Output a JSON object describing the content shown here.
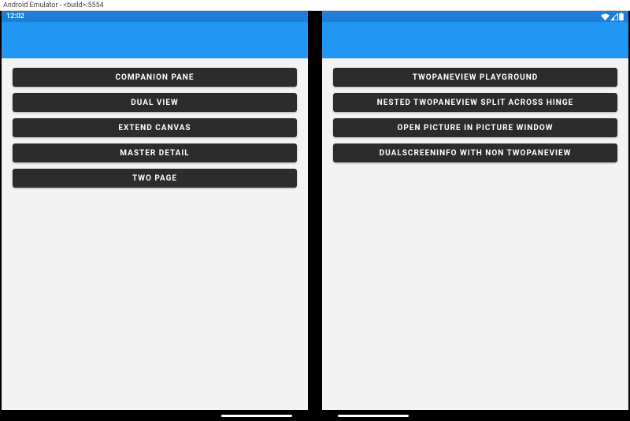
{
  "window": {
    "title": "Android Emulator - <build>:5554"
  },
  "status": {
    "time": "12:02"
  },
  "left_pane": {
    "buttons": [
      {
        "label": "COMPANION PANE"
      },
      {
        "label": "DUAL VIEW"
      },
      {
        "label": "EXTEND CANVAS"
      },
      {
        "label": "MASTER DETAIL"
      },
      {
        "label": "TWO PAGE"
      }
    ]
  },
  "right_pane": {
    "buttons": [
      {
        "label": "TWOPANEVIEW PLAYGROUND"
      },
      {
        "label": "NESTED TWOPANEVIEW SPLIT ACROSS HINGE"
      },
      {
        "label": "OPEN PICTURE IN PICTURE WINDOW"
      },
      {
        "label": "DUALSCREENINFO WITH NON TWOPANEVIEW"
      }
    ]
  }
}
